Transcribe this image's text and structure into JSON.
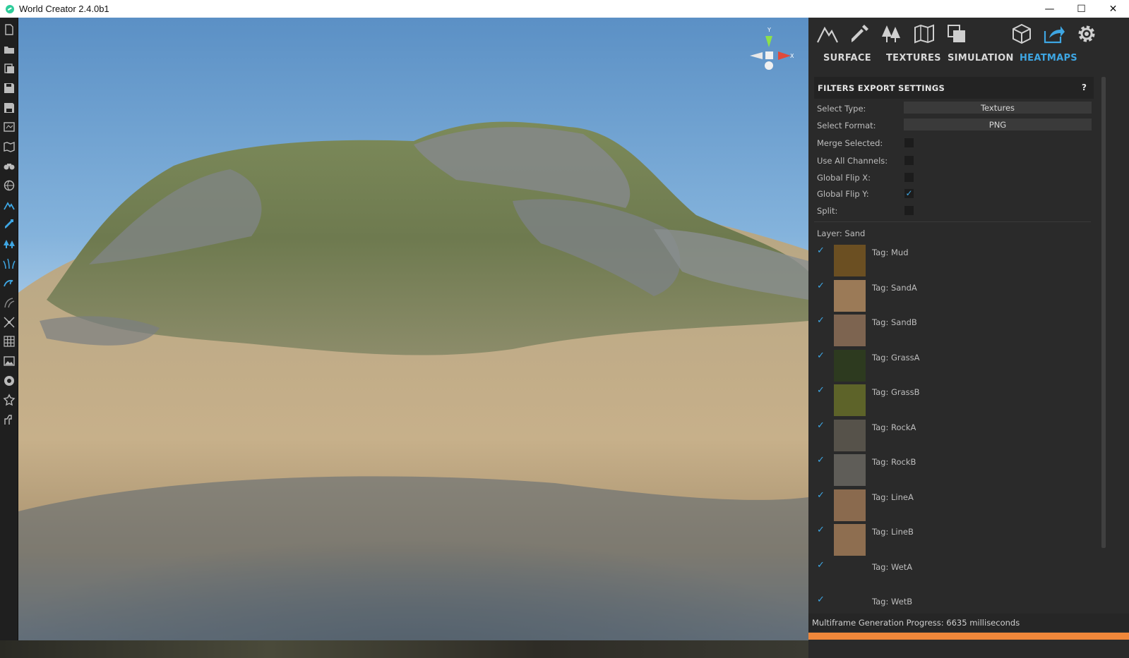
{
  "window": {
    "title": "World Creator 2.4.0b1",
    "minimize": "—",
    "maximize": "☐",
    "close": "✕"
  },
  "left_toolbar": {
    "icons": [
      "new-file-icon",
      "open-folder-icon",
      "open-recent-icon",
      "save-icon",
      "save-as-icon",
      "world-map-icon",
      "map-icon",
      "binoculars-icon",
      "globe-icon",
      "terrain-icon",
      "paint-brush-icon",
      "trees-icon",
      "grass-icon",
      "water-icon",
      "roads-icon",
      "transform-icon",
      "grid-icon",
      "image-icon",
      "sphere-icon",
      "camera-icon",
      "brush-tool-icon"
    ]
  },
  "viewport": {
    "gizmo_axes": {
      "y": "Y",
      "x": "X"
    }
  },
  "panel": {
    "top_tools": [
      "terrain-icon",
      "paint-brush-icon",
      "trees-icon",
      "map-icon",
      "layers-icon",
      "box-icon",
      "export-icon",
      "settings-icon"
    ],
    "tabs": [
      {
        "label": "SURFACE",
        "active": false
      },
      {
        "label": "TEXTURES",
        "active": false
      },
      {
        "label": "SIMULATION",
        "active": false
      },
      {
        "label": "HEATMAPS",
        "active": true
      }
    ],
    "accent": "#3ea6e3",
    "section": {
      "title": "FILTERS EXPORT SETTINGS",
      "help": "?"
    },
    "settings": {
      "select_type_label": "Select Type:",
      "select_type_value": "Textures",
      "select_format_label": "Select Format:",
      "select_format_value": "PNG",
      "merge_selected_label": "Merge Selected:",
      "use_all_channels_label": "Use All Channels:",
      "global_flip_x_label": "Global Flip X:",
      "global_flip_y_label": "Global Flip Y:",
      "global_flip_y_check": "✓",
      "split_label": "Split:"
    },
    "layer_label": "Layer: Sand",
    "tags": [
      {
        "label": "Tag: Mud",
        "check": "✓",
        "color": "#6b4f22"
      },
      {
        "label": "Tag: SandA",
        "check": "✓",
        "color": "#9b7a57"
      },
      {
        "label": "Tag: SandB",
        "check": "✓",
        "color": "#7d6450"
      },
      {
        "label": "Tag: GrassA",
        "check": "✓",
        "color": "#2d3a1f"
      },
      {
        "label": "Tag: GrassB",
        "check": "✓",
        "color": "#5d6329"
      },
      {
        "label": "Tag: RockA",
        "check": "✓",
        "color": "#56524a"
      },
      {
        "label": "Tag: RockB",
        "check": "✓",
        "color": "#5f5d58"
      },
      {
        "label": "Tag: LineA",
        "check": "✓",
        "color": "#8a6a4e"
      },
      {
        "label": "Tag: LineB",
        "check": "✓",
        "color": "#8e6e50"
      },
      {
        "label": "Tag: WetA",
        "check": "✓",
        "color": "#2a2a2a"
      },
      {
        "label": "Tag: WetB",
        "check": "✓",
        "color": "#2a2a2a"
      }
    ],
    "status": "Multiframe Generation Progress: 6635 milliseconds",
    "progress_fraction": 1.0,
    "progress_color": "#f0873a"
  }
}
